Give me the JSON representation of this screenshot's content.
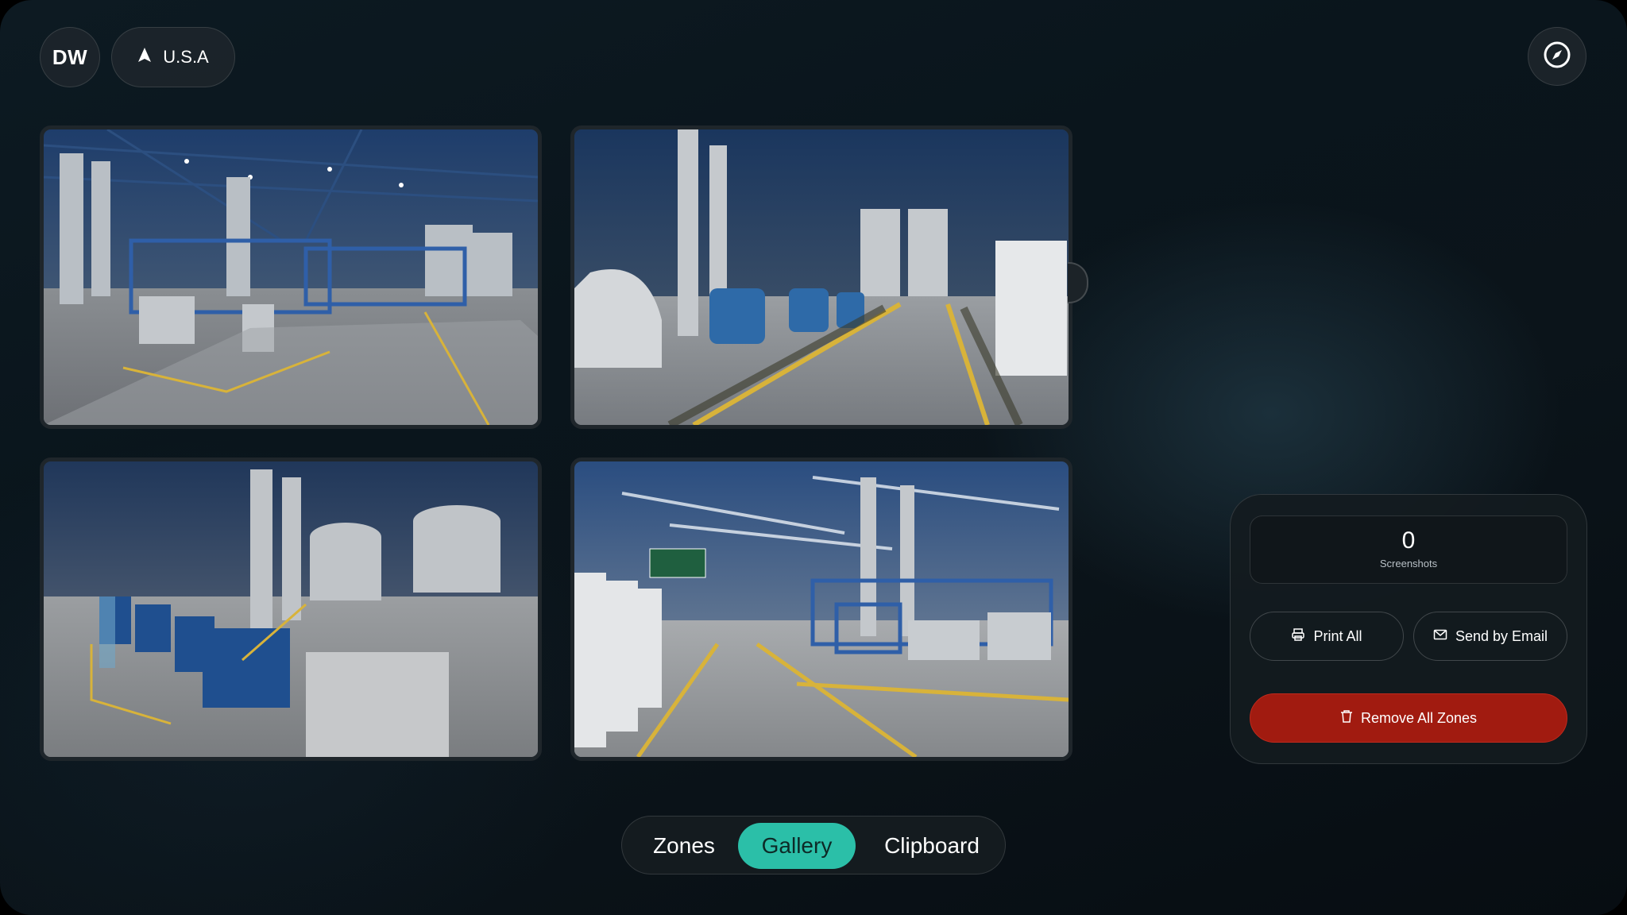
{
  "header": {
    "avatar_initials": "DW",
    "location_label": "U.S.A",
    "location_icon": "navigation-arrow-icon",
    "compass_icon": "compass-icon"
  },
  "gallery": {
    "images": [
      {
        "alt": "Industrial plant interior with steel tanks and piping"
      },
      {
        "alt": "Industrial plant interior with blue pumps and silos"
      },
      {
        "alt": "Industrial plant interior with blue compressor units"
      },
      {
        "alt": "Industrial plant interior with safety banner"
      }
    ]
  },
  "panel": {
    "screenshot_count": "0",
    "screenshot_label": "Screenshots",
    "print_label": "Print All",
    "print_icon": "printer-icon",
    "email_label": "Send by Email",
    "email_icon": "mail-icon",
    "remove_label": "Remove All Zones",
    "remove_icon": "trash-icon",
    "remove_color": "#a11b10"
  },
  "tabs": {
    "zones": "Zones",
    "gallery": "Gallery",
    "clipboard": "Clipboard",
    "active": "Gallery",
    "accent_color": "#2bbfa8"
  }
}
